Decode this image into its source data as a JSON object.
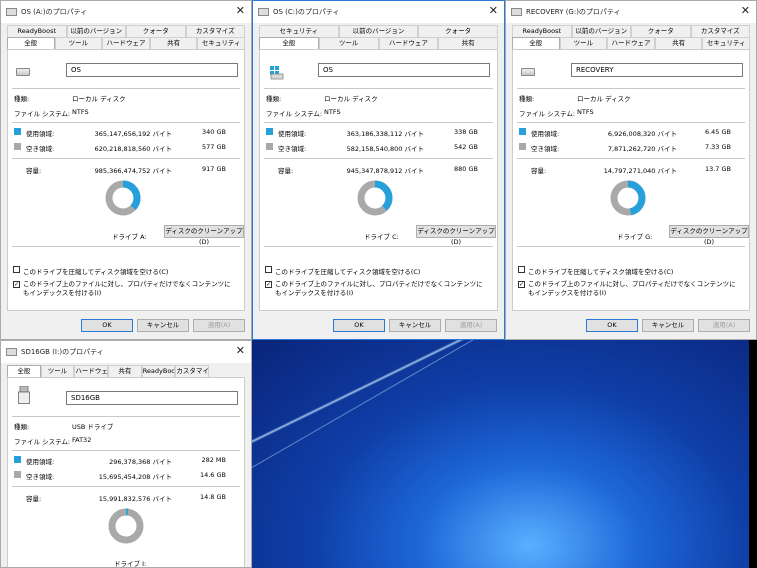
{
  "desktop": {
    "background": "#1d67d8"
  },
  "windows": [
    {
      "title": "OS (A:)のプロパティ",
      "tabs_top": [
        "ReadyBoost",
        "以前のバージョン",
        "クォータ",
        "カスタマイズ"
      ],
      "tabs_bottom": [
        "全般",
        "ツール",
        "ハードウェア",
        "共有",
        "セキュリティ"
      ],
      "name_value": "OS",
      "type_label": "種類:",
      "type_value": "ローカル ディスク",
      "fs_label": "ファイル システム:",
      "fs_value": "NTFS",
      "used_label": "使用領域:",
      "used_bytes": "365,147,656,192 バイト",
      "used_h": "340 GB",
      "free_label": "空き領域:",
      "free_bytes": "620,218,818,560 バイト",
      "free_h": "577 GB",
      "cap_label": "容量:",
      "cap_bytes": "985,366,474,752 バイト",
      "cap_h": "917 GB",
      "used_fraction": 0.37,
      "drive_label": "ドライブ A:",
      "cleanup": "ディスクのクリーンアップ(D)",
      "compress": "このドライブを圧縮してディスク領域を空ける(C)",
      "index": "このドライブ上のファイルに対し、プロパティだけでなくコンテンツにもインデックスを付ける(I)",
      "ok": "OK",
      "cancel": "キャンセル",
      "apply": "適用(A)"
    },
    {
      "title": "OS (C:)のプロパティ",
      "tabs_top": [
        "セキュリティ",
        "以前のバージョン",
        "クォータ"
      ],
      "tabs_bottom": [
        "全般",
        "ツール",
        "ハードウェア",
        "共有"
      ],
      "name_value": "OS",
      "type_label": "種類:",
      "type_value": "ローカル ディスク",
      "fs_label": "ファイル システム:",
      "fs_value": "NTFS",
      "used_label": "使用領域:",
      "used_bytes": "363,186,338,112 バイト",
      "used_h": "338 GB",
      "free_label": "空き領域:",
      "free_bytes": "582,158,540,800 バイト",
      "free_h": "542 GB",
      "cap_label": "容量:",
      "cap_bytes": "945,347,878,912 バイト",
      "cap_h": "880 GB",
      "used_fraction": 0.38,
      "drive_label": "ドライブ C:",
      "cleanup": "ディスクのクリーンアップ(D)",
      "compress": "このドライブを圧縮してディスク領域を空ける(C)",
      "index": "このドライブ上のファイルに対し、プロパティだけでなくコンテンツにもインデックスを付ける(I)",
      "ok": "OK",
      "cancel": "キャンセル",
      "apply": "適用(A)"
    },
    {
      "title": "RECOVERY (G:)のプロパティ",
      "tabs_top": [
        "ReadyBoost",
        "以前のバージョン",
        "クォータ",
        "カスタマイズ"
      ],
      "tabs_bottom": [
        "全般",
        "ツール",
        "ハードウェア",
        "共有",
        "セキュリティ"
      ],
      "name_value": "RECOVERY",
      "type_label": "種類:",
      "type_value": "ローカル ディスク",
      "fs_label": "ファイル システム:",
      "fs_value": "NTFS",
      "used_label": "使用領域:",
      "used_bytes": "6,926,008,320 バイト",
      "used_h": "6.45 GB",
      "free_label": "空き領域:",
      "free_bytes": "7,871,262,720 バイト",
      "free_h": "7.33 GB",
      "cap_label": "容量:",
      "cap_bytes": "14,797,271,040 バイト",
      "cap_h": "13.7 GB",
      "used_fraction": 0.47,
      "drive_label": "ドライブ G:",
      "cleanup": "ディスクのクリーンアップ(D)",
      "compress": "このドライブを圧縮してディスク領域を空ける(C)",
      "index": "このドライブ上のファイルに対し、プロパティだけでなくコンテンツにもインデックスを付ける(I)",
      "ok": "OK",
      "cancel": "キャンセル",
      "apply": "適用(A)"
    },
    {
      "title": "SD16GB (I:)のプロパティ",
      "tabs": [
        "全般",
        "ツール",
        "ハードウェア",
        "共有",
        "ReadyBoost",
        "カスタマイズ"
      ],
      "name_value": "SD16GB",
      "type_label": "種類:",
      "type_value": "USB ドライブ",
      "fs_label": "ファイル システム:",
      "fs_value": "FAT32",
      "used_label": "使用領域:",
      "used_bytes": "296,378,368 バイト",
      "used_h": "282 MB",
      "free_label": "空き領域:",
      "free_bytes": "15,695,454,208 バイト",
      "free_h": "14.6 GB",
      "cap_label": "容量:",
      "cap_bytes": "15,991,832,576 バイト",
      "cap_h": "14.8 GB",
      "used_fraction": 0.02,
      "drive_label": "ドライブ I:"
    }
  ],
  "close_glyph": "✕",
  "check_glyph": "✓",
  "colors": {
    "used": "#26a0da",
    "free": "#a9a9a9"
  }
}
